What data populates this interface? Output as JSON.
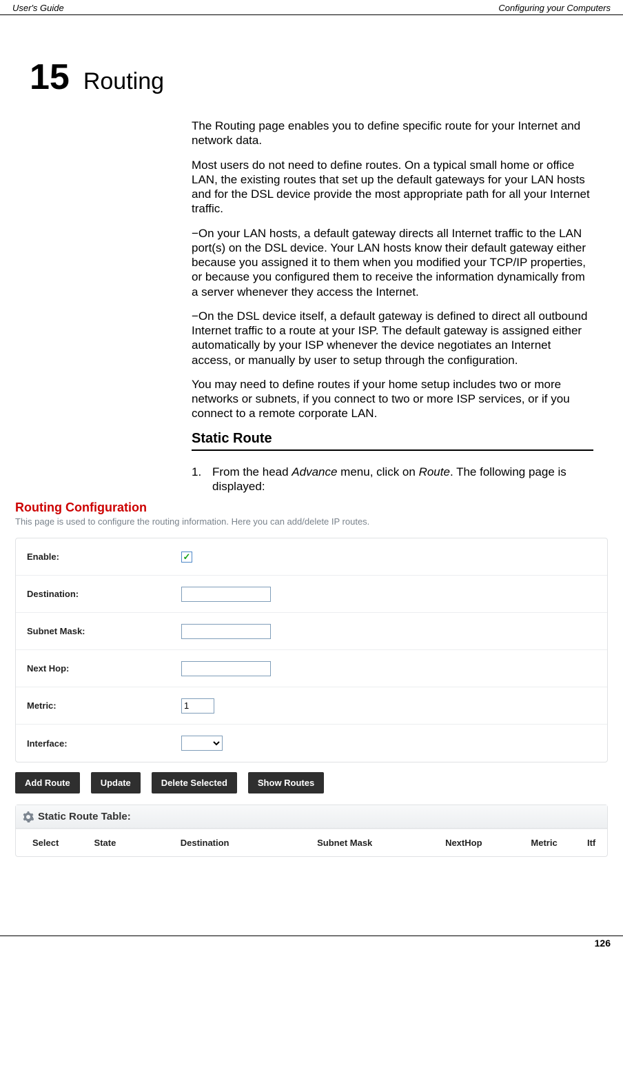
{
  "header": {
    "left": "User's Guide",
    "right": "Configuring your Computers"
  },
  "chapter": {
    "number": "15",
    "title": "Routing"
  },
  "paragraphs": {
    "p1": "The Routing page enables you to define specific route for your Internet and network data.",
    "p2": "Most users do not need to define routes. On a typical small home or office LAN, the existing routes that set up the default gateways for your LAN hosts and for the DSL device provide the most appropriate path for all your Internet traffic.",
    "p3": "−On your LAN hosts, a default gateway directs all Internet traffic to the LAN port(s) on the DSL device. Your LAN hosts know their default gateway either because you assigned it to them when you modified your TCP/IP properties, or because you configured them to receive the information dynamically from a server whenever they access the Internet.",
    "p4": "−On the DSL device itself, a default gateway is defined to direct all outbound Internet traffic to a route at your ISP. The default gateway is assigned either automatically by your ISP whenever the device negotiates an Internet access, or manually by user to setup through the configuration.",
    "p5": "You may need to define routes if your home setup includes two or more networks or subnets, if you connect to two or more ISP services, or if you connect to a remote corporate LAN."
  },
  "section": {
    "title": "Static Route",
    "step_num": "1.",
    "step_a": "From the head ",
    "step_b": "Advance",
    "step_c": " menu, click on ",
    "step_d": "Route",
    "step_e": ". The following page is displayed:"
  },
  "router": {
    "title": "Routing Configuration",
    "desc": "This page is used to configure the routing information. Here you can add/delete IP routes.",
    "fields": {
      "enable": "Enable:",
      "destination": "Destination:",
      "subnet_mask": "Subnet Mask:",
      "next_hop": "Next Hop:",
      "metric": "Metric:",
      "interface": "Interface:"
    },
    "values": {
      "enable_checked": "✓",
      "destination": "",
      "subnet_mask": "",
      "next_hop": "",
      "metric": "1",
      "interface": ""
    },
    "buttons": {
      "add": "Add Route",
      "update": "Update",
      "delete": "Delete Selected",
      "show": "Show Routes"
    },
    "table": {
      "title": "Static Route Table:",
      "headers": {
        "select": "Select",
        "state": "State",
        "destination": "Destination",
        "subnet_mask": "Subnet Mask",
        "nexthop": "NextHop",
        "metric": "Metric",
        "itf": "Itf"
      }
    }
  },
  "footer": {
    "page": "126"
  }
}
